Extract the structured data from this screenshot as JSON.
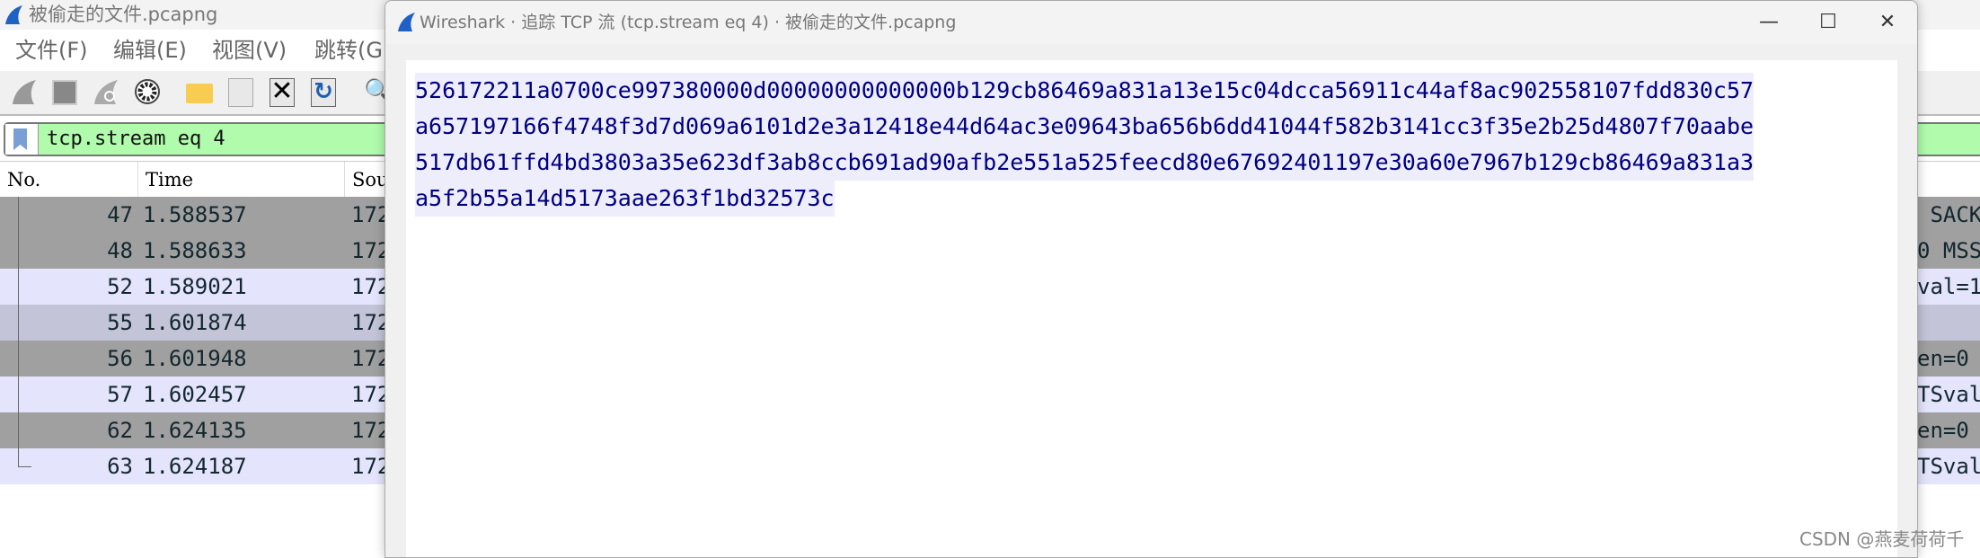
{
  "main_window": {
    "title": "被偷走的文件.pcapng"
  },
  "menu": [
    "文件(F)",
    "编辑(E)",
    "视图(V)",
    "跳转(G)"
  ],
  "toolbar": [
    "start-capture-icon",
    "stop-capture-icon",
    "restart-capture-icon",
    "capture-options-icon",
    "open-file-icon",
    "file-icon",
    "close-file-icon",
    "reload-file-icon",
    "find-packet-icon"
  ],
  "filter": {
    "value": "tcp.stream eq 4",
    "bg": "#b0fcac"
  },
  "packet_list": {
    "columns": [
      "No.",
      "Time",
      "Sou"
    ],
    "rows": [
      {
        "no": "47",
        "time": "1.588537",
        "src": "172",
        "info": " SACK",
        "bg": "#a0a0a0"
      },
      {
        "no": "48",
        "time": "1.588633",
        "src": "172",
        "info": "0 MSS",
        "bg": "#a0a0a0"
      },
      {
        "no": "52",
        "time": "1.589021",
        "src": "172",
        "info": "val=1",
        "bg": "#e4e4fc"
      },
      {
        "no": "55",
        "time": "1.601874",
        "src": "172",
        "info": "",
        "bg": "#c4c4d8"
      },
      {
        "no": "56",
        "time": "1.601948",
        "src": "172",
        "info": "en=0",
        "bg": "#a0a0a0"
      },
      {
        "no": "57",
        "time": "1.602457",
        "src": "172",
        "info": "TSval",
        "bg": "#e4e4fc"
      },
      {
        "no": "62",
        "time": "1.624135",
        "src": "172",
        "info": "en=0",
        "bg": "#a0a0a0"
      },
      {
        "no": "63",
        "time": "1.624187",
        "src": "172",
        "info": "TSval",
        "bg": "#e4e4fc"
      }
    ]
  },
  "dialog": {
    "title": "Wireshark · 追踪 TCP 流 (tcp.stream eq 4) · 被偷走的文件.pcapng",
    "minimize": "—",
    "maximize": "☐",
    "close": "✕",
    "stream_lines": [
      "526172211a0700ce997380000d00000000000000b129cb86469a831a13e15c04dcca56911c44af8ac902558107fdd830c57",
      "a657197166f4748f3d7d069a6101d2e3a12418e44d64ac3e09643ba656b6dd41044f582b3141cc3f35e2b25d4807f70aabe",
      "517db61ffd4bd3803a35e623df3ab8ccb691ad90afb2e551a525feecd80e67692401197e30a60e7967b129cb86469a831a3",
      "a5f2b55a14d5173aae263f1bd32573c"
    ],
    "text_color": "#000080"
  },
  "watermark": "CSDN @燕麦荷荷千"
}
